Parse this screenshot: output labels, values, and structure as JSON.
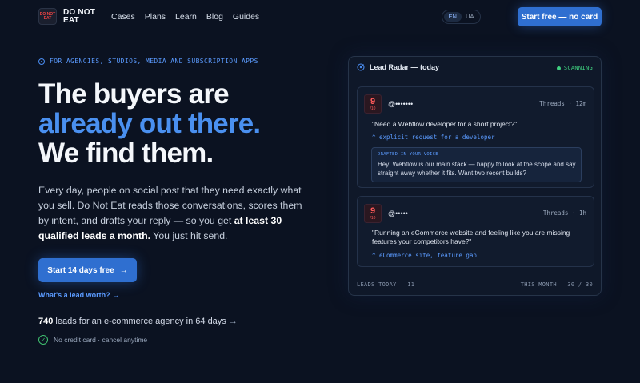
{
  "nav": {
    "logo_mark": "DO NOT EAT",
    "logo_text": "DO NOT EAT",
    "links": [
      "Cases",
      "Plans",
      "Learn",
      "Blog",
      "Guides"
    ],
    "languages": [
      "EN",
      "UA"
    ],
    "active_language": "EN",
    "cta": "Start free — no card"
  },
  "hero": {
    "eyebrow": "FOR AGENCIES, STUDIOS, MEDIA AND SUBSCRIPTION APPS",
    "headline_1": "The buyers are",
    "headline_2": "already out there.",
    "headline_3": "We find them.",
    "lede_part1": "Every day, people on social post that they need exactly what you sell. Do Not Eat reads those conversations, scores them by intent, and drafts your reply — so you get ",
    "lede_bold": "at least 30 qualified leads a month.",
    "lede_part2": " You just hit send.",
    "cta": "Start 14 days free",
    "lead_link": "What's a lead worth? →",
    "proof_bold": "740",
    "proof_text": " leads for an e-commerce agency in 64 days",
    "no_card": "No credit card · cancel anytime"
  },
  "radar": {
    "title": "Lead Radar — today",
    "status": "SCANNING",
    "posts": [
      {
        "score": "9",
        "score_denominator": "/10",
        "handle": "@•••••••",
        "source": "Threads · 12m",
        "quote": "\"Need a Webflow developer for a short project?\"",
        "intent": "^ explicit request for a developer",
        "draft_label": "DRAFTED IN YOUR VOICE",
        "draft": "Hey! Webflow is our main stack — happy to look at the scope and say straight away whether it fits. Want two recent builds?"
      },
      {
        "score": "9",
        "score_denominator": "/10",
        "handle": "@•••••",
        "source": "Threads · 1h",
        "quote": "\"Running an eCommerce website and feeling like you are missing features your competitors have?\"",
        "intent": "^ eCommerce site, feature gap"
      }
    ],
    "footer_left": "LEADS TODAY — 11",
    "footer_right": "THIS MONTH — 30 / 30"
  },
  "colors": {
    "background": "#0b1221",
    "accent": "#2f6fd0",
    "accent_text": "#4a90f0",
    "score_red": "#ff5a5a",
    "scan_green": "#3fcf7f"
  }
}
